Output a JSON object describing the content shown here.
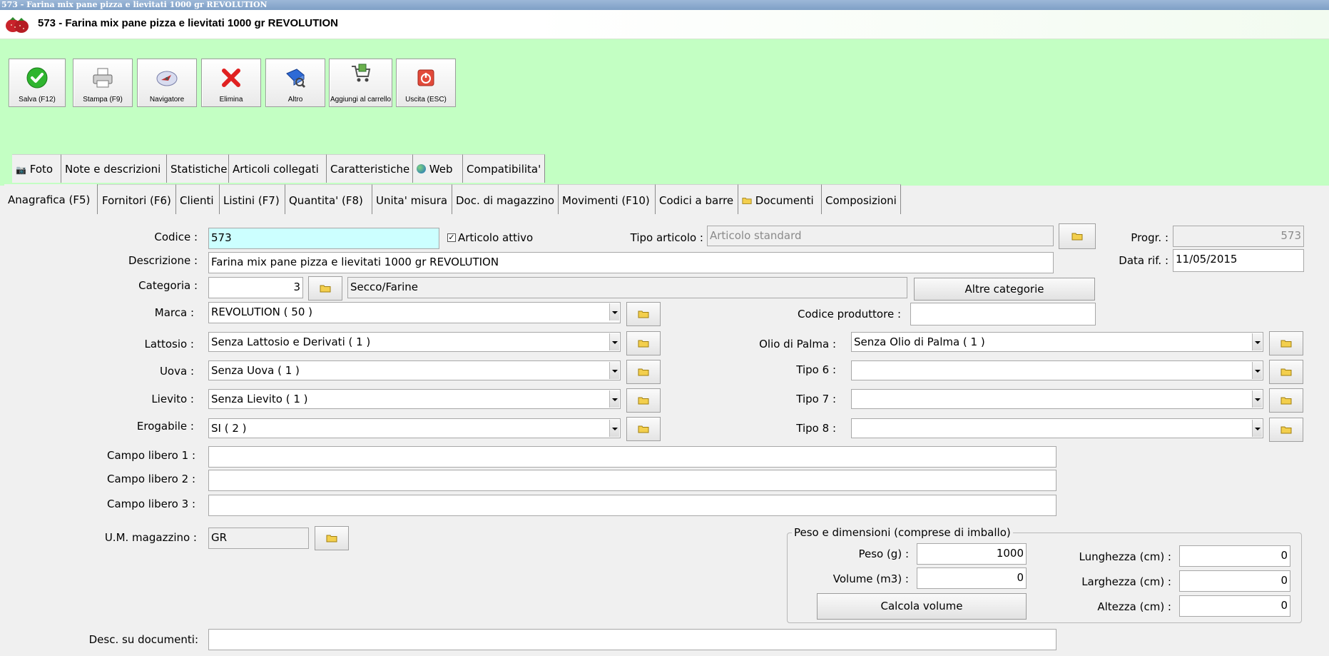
{
  "window": {
    "title": "573 - Farina mix pane pizza e lievitati 1000 gr REVOLUTION"
  },
  "header": {
    "title": "573 - Farina mix pane pizza e lievitati 1000 gr REVOLUTION",
    "logo_icon": "strawberries-icon"
  },
  "toolbar": [
    {
      "label": "Salva (F12)",
      "icon": "checkmark-icon"
    },
    {
      "label": "Stampa (F9)",
      "icon": "printer-icon"
    },
    {
      "label": "Navigatore",
      "icon": "compass-icon"
    },
    {
      "label": "Elimina",
      "icon": "delete-x-icon"
    },
    {
      "label": "Altro",
      "icon": "book-icon"
    },
    {
      "label": "Aggiungi al carrello",
      "icon": "cart-icon"
    },
    {
      "label": "Uscita (ESC)",
      "icon": "power-icon"
    }
  ],
  "tabs_row1": [
    {
      "label": "Foto",
      "icon": "camera-icon"
    },
    {
      "label": "Note e descrizioni"
    },
    {
      "label": "Statistiche"
    },
    {
      "label": "Articoli collegati"
    },
    {
      "label": "Caratteristiche"
    },
    {
      "label": "Web",
      "icon": "globe-icon"
    },
    {
      "label": "Compatibilita'"
    }
  ],
  "tabs_row2": [
    {
      "label": "Anagrafica (F5)",
      "active": true
    },
    {
      "label": "Fornitori (F6)"
    },
    {
      "label": "Clienti"
    },
    {
      "label": "Listini (F7)"
    },
    {
      "label": "Quantita' (F8)"
    },
    {
      "label": "Unita' misura"
    },
    {
      "label": "Doc. di magazzino"
    },
    {
      "label": "Movimenti (F10)"
    },
    {
      "label": "Codici a barre"
    },
    {
      "label": "Documenti",
      "icon": "folder-icon"
    },
    {
      "label": "Composizioni"
    }
  ],
  "form": {
    "codice": {
      "label": "Codice :",
      "value": "573"
    },
    "articolo_attivo": {
      "label": "Articolo attivo",
      "checked": true
    },
    "tipo_articolo": {
      "label": "Tipo articolo :",
      "placeholder": "Articolo standard"
    },
    "progr": {
      "label": "Progr. :",
      "value": "573"
    },
    "descrizione": {
      "label": "Descrizione :",
      "value": "Farina mix pane pizza e lievitati 1000 gr REVOLUTION"
    },
    "data_rif": {
      "label": "Data rif. :",
      "value": "11/05/2015"
    },
    "categoria": {
      "label": "Categoria :",
      "code": "3",
      "name": "Secco/Farine"
    },
    "altre_categorie": {
      "label": "Altre categorie"
    },
    "marca": {
      "label": "Marca :",
      "value": "REVOLUTION ( 50 )"
    },
    "codice_produttore": {
      "label": "Codice produttore :",
      "value": ""
    },
    "lattosio": {
      "label": "Lattosio :",
      "value": "Senza Lattosio e Derivati ( 1 )"
    },
    "olio_palma": {
      "label": "Olio di Palma :",
      "value": "Senza Olio di Palma ( 1 )"
    },
    "uova": {
      "label": "Uova :",
      "value": "Senza Uova ( 1 )"
    },
    "tipo6": {
      "label": "Tipo 6 :",
      "value": ""
    },
    "lievito": {
      "label": "Lievito :",
      "value": "Senza Lievito ( 1 )"
    },
    "tipo7": {
      "label": "Tipo 7 :",
      "value": ""
    },
    "erogabile": {
      "label": "Erogabile :",
      "value": "SI ( 2 )"
    },
    "tipo8": {
      "label": "Tipo 8 :",
      "value": ""
    },
    "campo1": {
      "label": "Campo libero 1 :",
      "value": ""
    },
    "campo2": {
      "label": "Campo libero 2 :",
      "value": ""
    },
    "campo3": {
      "label": "Campo libero 3 :",
      "value": ""
    },
    "um_magazzino": {
      "label": "U.M. magazzino :",
      "value": "GR"
    },
    "desc_documenti": {
      "label": "Desc. su documenti:",
      "value": ""
    }
  },
  "peso_group": {
    "title": "Peso e dimensioni (comprese di imballo)",
    "peso": {
      "label": "Peso (g) :",
      "value": "1000"
    },
    "volume": {
      "label": "Volume (m3) :",
      "value": "0"
    },
    "calcola": {
      "label": "Calcola volume"
    },
    "lunghezza": {
      "label": "Lunghezza (cm) :",
      "value": "0"
    },
    "larghezza": {
      "label": "Larghezza (cm) :",
      "value": "0"
    },
    "altezza": {
      "label": "Altezza (cm) :",
      "value": "0"
    }
  },
  "colors": {
    "green_bg": "#c3ffc3",
    "codice_bg": "#ccffff",
    "titlebar": "#8aa9cf"
  }
}
